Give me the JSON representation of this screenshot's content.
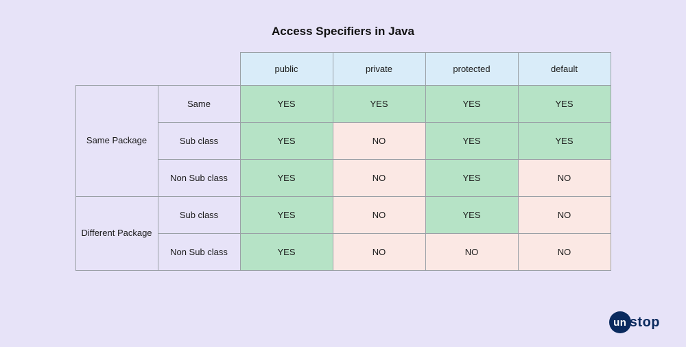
{
  "title": "Access Specifiers in Java",
  "columns": [
    "public",
    "private",
    "protected",
    "default"
  ],
  "groups": [
    {
      "label": "Same Package",
      "rows": [
        {
          "label": "Same",
          "cells": [
            "YES",
            "YES",
            "YES",
            "YES"
          ]
        },
        {
          "label": "Sub class",
          "cells": [
            "YES",
            "NO",
            "YES",
            "YES"
          ]
        },
        {
          "label": "Non Sub class",
          "cells": [
            "YES",
            "NO",
            "YES",
            "NO"
          ]
        }
      ]
    },
    {
      "label": "Different Package",
      "rows": [
        {
          "label": "Sub class",
          "cells": [
            "YES",
            "NO",
            "YES",
            "NO"
          ]
        },
        {
          "label": "Non Sub class",
          "cells": [
            "YES",
            "NO",
            "NO",
            "NO"
          ]
        }
      ]
    }
  ],
  "logo": {
    "badge": "un",
    "rest": "stop"
  },
  "chart_data": {
    "type": "table",
    "title": "Access Specifiers in Java",
    "columns": [
      "public",
      "private",
      "protected",
      "default"
    ],
    "row_groups": [
      "Same Package",
      "Same Package",
      "Same Package",
      "Different Package",
      "Different Package"
    ],
    "row_labels": [
      "Same",
      "Sub class",
      "Non Sub class",
      "Sub class",
      "Non Sub class"
    ],
    "values": [
      [
        "YES",
        "YES",
        "YES",
        "YES"
      ],
      [
        "YES",
        "NO",
        "YES",
        "YES"
      ],
      [
        "YES",
        "NO",
        "YES",
        "NO"
      ],
      [
        "YES",
        "NO",
        "YES",
        "NO"
      ],
      [
        "YES",
        "NO",
        "NO",
        "NO"
      ]
    ]
  }
}
